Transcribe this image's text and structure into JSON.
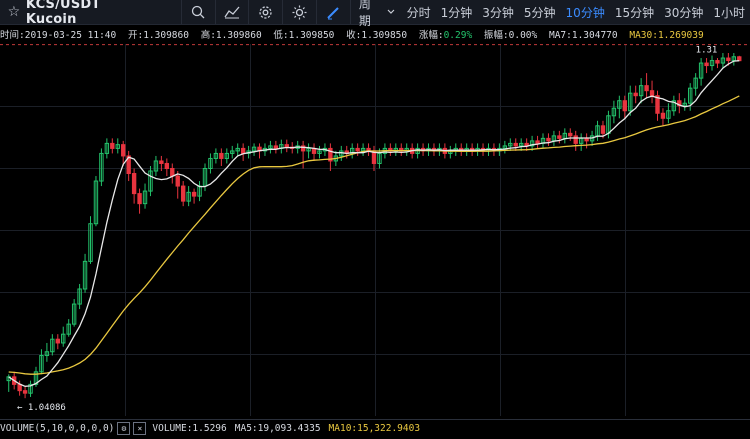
{
  "header": {
    "title": "KCS/USDT Kucoin",
    "period_label": "周期",
    "timeframes": [
      "分时",
      "1分钟",
      "3分钟",
      "5分钟",
      "10分钟",
      "15分钟",
      "30分钟",
      "1小时"
    ],
    "active_timeframe": "10分钟"
  },
  "info": {
    "time": "时间:2019-03-25 11:40",
    "open": "开:1.309860",
    "high": "高:1.309860",
    "low": "低:1.309850",
    "close": "收:1.309850",
    "change_label": "涨幅:",
    "change_value": "0.29%",
    "amplitude": "振幅:0.00%",
    "ma7": "MA7:1.304770",
    "ma30": "MA30:1.269039"
  },
  "chart_data": {
    "type": "candlestick",
    "high_label": "1.31",
    "low_label": "← 1.04086",
    "colors": {
      "up": "#23c26b",
      "down": "#e8343f",
      "ma7": "#e8e8e8",
      "ma30": "#e9c840"
    },
    "ylim": [
      1.03,
      1.32
    ],
    "candles": [
      [
        1.055,
        1.058,
        1.046,
        1.06
      ],
      [
        1.058,
        1.052,
        1.048,
        1.062
      ],
      [
        1.052,
        1.047,
        1.043,
        1.055
      ],
      [
        1.047,
        1.045,
        1.041,
        1.05
      ],
      [
        1.045,
        1.052,
        1.042,
        1.055
      ],
      [
        1.052,
        1.062,
        1.05,
        1.066
      ],
      [
        1.062,
        1.075,
        1.06,
        1.08
      ],
      [
        1.075,
        1.078,
        1.07,
        1.085
      ],
      [
        1.078,
        1.088,
        1.075,
        1.092
      ],
      [
        1.088,
        1.085,
        1.08,
        1.092
      ],
      [
        1.085,
        1.092,
        1.082,
        1.098
      ],
      [
        1.092,
        1.1,
        1.09,
        1.104
      ],
      [
        1.1,
        1.116,
        1.098,
        1.12
      ],
      [
        1.116,
        1.128,
        1.112,
        1.132
      ],
      [
        1.128,
        1.15,
        1.125,
        1.156
      ],
      [
        1.15,
        1.18,
        1.148,
        1.186
      ],
      [
        1.18,
        1.214,
        1.178,
        1.218
      ],
      [
        1.214,
        1.236,
        1.21,
        1.24
      ],
      [
        1.236,
        1.244,
        1.232,
        1.248
      ],
      [
        1.244,
        1.24,
        1.236,
        1.248
      ],
      [
        1.24,
        1.243,
        1.236,
        1.248
      ],
      [
        1.243,
        1.234,
        1.226,
        1.246
      ],
      [
        1.234,
        1.22,
        1.214,
        1.238
      ],
      [
        1.22,
        1.204,
        1.196,
        1.224
      ],
      [
        1.204,
        1.196,
        1.188,
        1.208
      ],
      [
        1.196,
        1.206,
        1.192,
        1.212
      ],
      [
        1.206,
        1.222,
        1.202,
        1.226
      ],
      [
        1.222,
        1.23,
        1.218,
        1.234
      ],
      [
        1.23,
        1.228,
        1.222,
        1.234
      ],
      [
        1.228,
        1.224,
        1.218,
        1.232
      ],
      [
        1.224,
        1.218,
        1.212,
        1.228
      ],
      [
        1.218,
        1.21,
        1.2,
        1.222
      ],
      [
        1.21,
        1.198,
        1.194,
        1.214
      ],
      [
        1.198,
        1.205,
        1.194,
        1.21
      ],
      [
        1.205,
        1.202,
        1.196,
        1.208
      ],
      [
        1.202,
        1.21,
        1.198,
        1.214
      ],
      [
        1.21,
        1.224,
        1.206,
        1.228
      ],
      [
        1.224,
        1.232,
        1.22,
        1.236
      ],
      [
        1.232,
        1.236,
        1.228,
        1.24
      ],
      [
        1.236,
        1.232,
        1.226,
        1.24
      ],
      [
        1.232,
        1.236,
        1.228,
        1.24
      ],
      [
        1.236,
        1.238,
        1.232,
        1.242
      ],
      [
        1.238,
        1.24,
        1.234,
        1.244
      ],
      [
        1.24,
        1.236,
        1.23,
        1.244
      ],
      [
        1.236,
        1.238,
        1.232,
        1.242
      ],
      [
        1.238,
        1.241,
        1.234,
        1.244
      ],
      [
        1.241,
        1.238,
        1.232,
        1.244
      ],
      [
        1.238,
        1.24,
        1.234,
        1.244
      ],
      [
        1.24,
        1.242,
        1.236,
        1.246
      ],
      [
        1.242,
        1.24,
        1.236,
        1.246
      ],
      [
        1.24,
        1.243,
        1.236,
        1.247
      ],
      [
        1.243,
        1.241,
        1.237,
        1.247
      ],
      [
        1.241,
        1.24,
        1.236,
        1.245
      ],
      [
        1.24,
        1.242,
        1.236,
        1.246
      ],
      [
        1.242,
        1.238,
        1.224,
        1.246
      ],
      [
        1.238,
        1.24,
        1.232,
        1.244
      ],
      [
        1.24,
        1.236,
        1.23,
        1.244
      ],
      [
        1.236,
        1.238,
        1.232,
        1.242
      ],
      [
        1.238,
        1.24,
        1.234,
        1.244
      ],
      [
        1.24,
        1.23,
        1.222,
        1.244
      ],
      [
        1.23,
        1.234,
        1.226,
        1.238
      ],
      [
        1.234,
        1.238,
        1.23,
        1.242
      ],
      [
        1.238,
        1.236,
        1.232,
        1.242
      ],
      [
        1.236,
        1.24,
        1.232,
        1.244
      ],
      [
        1.24,
        1.238,
        1.234,
        1.244
      ],
      [
        1.238,
        1.24,
        1.234,
        1.244
      ],
      [
        1.24,
        1.238,
        1.234,
        1.244
      ],
      [
        1.238,
        1.228,
        1.222,
        1.242
      ],
      [
        1.228,
        1.236,
        1.224,
        1.24
      ],
      [
        1.236,
        1.24,
        1.232,
        1.244
      ],
      [
        1.24,
        1.238,
        1.234,
        1.244
      ],
      [
        1.238,
        1.24,
        1.234,
        1.244
      ],
      [
        1.24,
        1.238,
        1.234,
        1.244
      ],
      [
        1.238,
        1.24,
        1.234,
        1.244
      ],
      [
        1.24,
        1.236,
        1.232,
        1.244
      ],
      [
        1.236,
        1.24,
        1.232,
        1.244
      ],
      [
        1.24,
        1.238,
        1.234,
        1.244
      ],
      [
        1.238,
        1.24,
        1.234,
        1.244
      ],
      [
        1.24,
        1.238,
        1.234,
        1.244
      ],
      [
        1.238,
        1.24,
        1.234,
        1.244
      ],
      [
        1.24,
        1.236,
        1.232,
        1.244
      ],
      [
        1.236,
        1.238,
        1.232,
        1.242
      ],
      [
        1.238,
        1.24,
        1.234,
        1.244
      ],
      [
        1.24,
        1.238,
        1.234,
        1.244
      ],
      [
        1.238,
        1.24,
        1.234,
        1.244
      ],
      [
        1.24,
        1.238,
        1.234,
        1.244
      ],
      [
        1.238,
        1.24,
        1.234,
        1.244
      ],
      [
        1.24,
        1.238,
        1.234,
        1.244
      ],
      [
        1.238,
        1.24,
        1.234,
        1.244
      ],
      [
        1.24,
        1.238,
        1.234,
        1.244
      ],
      [
        1.238,
        1.24,
        1.234,
        1.244
      ],
      [
        1.24,
        1.242,
        1.236,
        1.246
      ],
      [
        1.242,
        1.244,
        1.238,
        1.248
      ],
      [
        1.244,
        1.242,
        1.238,
        1.248
      ],
      [
        1.242,
        1.244,
        1.238,
        1.248
      ],
      [
        1.244,
        1.242,
        1.238,
        1.248
      ],
      [
        1.242,
        1.246,
        1.238,
        1.25
      ],
      [
        1.246,
        1.244,
        1.24,
        1.25
      ],
      [
        1.244,
        1.248,
        1.24,
        1.252
      ],
      [
        1.248,
        1.246,
        1.242,
        1.252
      ],
      [
        1.246,
        1.25,
        1.242,
        1.254
      ],
      [
        1.25,
        1.248,
        1.244,
        1.254
      ],
      [
        1.248,
        1.252,
        1.244,
        1.256
      ],
      [
        1.252,
        1.25,
        1.246,
        1.256
      ],
      [
        1.25,
        1.244,
        1.238,
        1.254
      ],
      [
        1.244,
        1.248,
        1.238,
        1.252
      ],
      [
        1.248,
        1.246,
        1.24,
        1.252
      ],
      [
        1.246,
        1.25,
        1.242,
        1.254
      ],
      [
        1.25,
        1.258,
        1.246,
        1.262
      ],
      [
        1.258,
        1.252,
        1.248,
        1.262
      ],
      [
        1.252,
        1.266,
        1.248,
        1.27
      ],
      [
        1.266,
        1.272,
        1.26,
        1.278
      ],
      [
        1.272,
        1.278,
        1.264,
        1.282
      ],
      [
        1.278,
        1.27,
        1.264,
        1.282
      ],
      [
        1.27,
        1.284,
        1.266,
        1.29
      ],
      [
        1.284,
        1.282,
        1.276,
        1.29
      ],
      [
        1.282,
        1.29,
        1.276,
        1.296
      ],
      [
        1.29,
        1.286,
        1.28,
        1.3
      ],
      [
        1.286,
        1.282,
        1.276,
        1.294
      ],
      [
        1.282,
        1.268,
        1.262,
        1.286
      ],
      [
        1.268,
        1.264,
        1.258,
        1.272
      ],
      [
        1.264,
        1.27,
        1.26,
        1.276
      ],
      [
        1.27,
        1.278,
        1.266,
        1.282
      ],
      [
        1.278,
        1.274,
        1.268,
        1.284
      ],
      [
        1.274,
        1.276,
        1.27,
        1.28
      ],
      [
        1.276,
        1.288,
        1.27,
        1.292
      ],
      [
        1.288,
        1.296,
        1.282,
        1.3
      ],
      [
        1.296,
        1.308,
        1.29,
        1.312
      ],
      [
        1.308,
        1.306,
        1.3,
        1.312
      ],
      [
        1.306,
        1.31,
        1.302,
        1.314
      ],
      [
        1.31,
        1.308,
        1.304,
        1.312
      ],
      [
        1.308,
        1.312,
        1.304,
        1.316
      ],
      [
        1.312,
        1.31,
        1.306,
        1.316
      ],
      [
        1.31,
        1.313,
        1.306,
        1.316
      ],
      [
        1.313,
        1.3099,
        1.3098,
        1.3138
      ]
    ]
  },
  "volume": {
    "label": "VOLUME(5,10,0,0,0,0)",
    "value": "VOLUME:1.5296",
    "ma5": "MA5:19,093.4335",
    "ma10": "MA10:15,322.9403"
  }
}
